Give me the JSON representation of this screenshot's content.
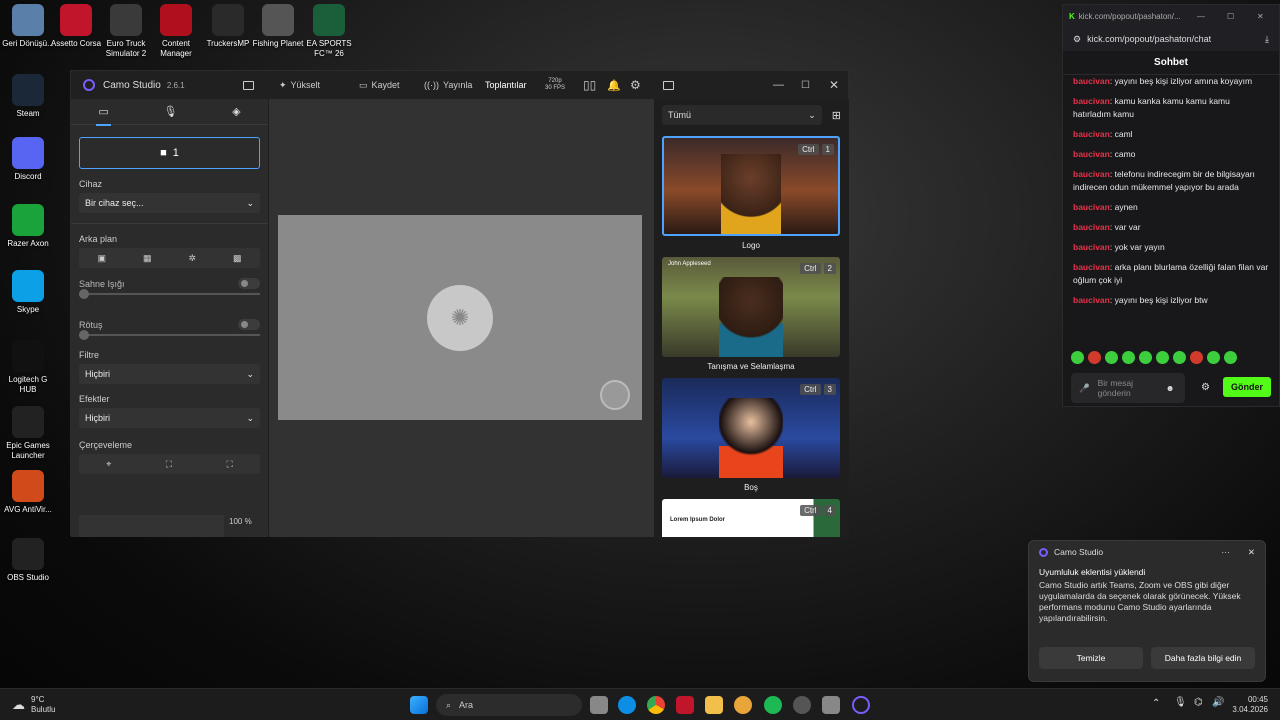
{
  "desktop": [
    {
      "label": "Geri Dönüşü...",
      "icon": "recycle-bin-icon",
      "color": "#5a7fa8"
    },
    {
      "label": "Assetto Corsa",
      "icon": "assetto-corsa-icon",
      "color": "#c0152a"
    },
    {
      "label": "Euro Truck Simulator 2",
      "icon": "ets2-icon",
      "color": "#3a3a3a"
    },
    {
      "label": "Content Manager",
      "icon": "content-manager-icon",
      "color": "#b0101e"
    },
    {
      "label": "TruckersMP",
      "icon": "truckersmp-icon",
      "color": "#2a2a2a"
    },
    {
      "label": "Fishing Planet",
      "icon": "fishing-planet-icon",
      "color": "#555"
    },
    {
      "label": "EA SPORTS FC™ 26",
      "icon": "ea-fc-icon",
      "color": "#1a5e3a"
    },
    {
      "label": "Steam",
      "icon": "steam-icon",
      "color": "#1b2838"
    },
    {
      "label": "Discord",
      "icon": "discord-icon",
      "color": "#5865f2"
    },
    {
      "label": "Razer Axon",
      "icon": "razer-icon",
      "color": "#1aa33a"
    },
    {
      "label": "Skype",
      "icon": "skype-icon",
      "color": "#0ca0e6"
    },
    {
      "label": "Logitech G HUB",
      "icon": "logitech-icon",
      "color": "#111"
    },
    {
      "label": "Epic Games Launcher",
      "icon": "epic-icon",
      "color": "#222"
    },
    {
      "label": "AVG AntiVir...",
      "icon": "avg-icon",
      "color": "#d04a1a"
    },
    {
      "label": "OBS Studio",
      "icon": "obs-icon",
      "color": "#222"
    }
  ],
  "camo": {
    "name": "Camo Studio",
    "version": "2.6.1",
    "toolbar": {
      "upgrade": "Yükselt",
      "record": "Kaydet",
      "broadcast": "Yayınla",
      "meetings": "Toplantılar",
      "resolution": "720p",
      "fps": "30 FPS"
    },
    "camera_label": "1",
    "device_label": "Cihaz",
    "device_value": "Bir cihaz seç...",
    "background_label": "Arka plan",
    "stage_light": "Sahne Işığı",
    "retouch": "Rötuş",
    "filter_label": "Filtre",
    "filter_value": "Hiçbiri",
    "effects_label": "Efektler",
    "effects_value": "Hiçbiri",
    "framing_label": "Çerçeveleme",
    "zoom_value": "100 %",
    "scene_filter": "Tümü",
    "ctrl_key": "Ctrl",
    "scenes": [
      {
        "num": "1",
        "caption": "Logo"
      },
      {
        "num": "2",
        "caption": "Tanışma ve Selamlaşma",
        "overlay": "John Appleseed"
      },
      {
        "num": "3",
        "caption": "Boş"
      },
      {
        "num": "4",
        "caption": "",
        "overlay": "Lorem Ipsum Dolor"
      }
    ]
  },
  "chat": {
    "tab_url": "kick.com/popout/pashaton/...",
    "url": "kick.com/popout/pashaton/chat",
    "header": "Sohbet",
    "messages": [
      {
        "user": "baucivan",
        "text": "yayını beş kişi izliyor amına koyayım"
      },
      {
        "user": "baucivan",
        "text": "kamu kanka kamu kamu kamu hatırladım kamu"
      },
      {
        "user": "baucivan",
        "text": "caml"
      },
      {
        "user": "baucivan",
        "text": "camo"
      },
      {
        "user": "baucivan",
        "text": "telefonu indirecegim bir de bilgisayarı indirecen odun mükemmel yapıyor bu arada"
      },
      {
        "user": "baucivan",
        "text": "aynen"
      },
      {
        "user": "baucivan",
        "text": "var var"
      },
      {
        "user": "baucivan",
        "text": "yok var yayın"
      },
      {
        "user": "baucivan",
        "text": "arka planı blurlama özelliği falan filan var oğlum çok iyi"
      },
      {
        "user": "baucivan",
        "text": "yayını beş kişi izliyor btw"
      }
    ],
    "input_placeholder": "Bir mesaj gönderin",
    "send_label": "Gönder"
  },
  "toast": {
    "app": "Camo Studio",
    "title": "Uyumluluk eklentisi yüklendi",
    "body": "Camo Studio artık Teams, Zoom ve OBS gibi diğer uygulamalarda da seçenek olarak görünecek. Yüksek performans modunu Camo Studio ayarlarında yapılandırabilirsin.",
    "btn_clear": "Temizle",
    "btn_more": "Daha fazla bilgi edin"
  },
  "taskbar": {
    "temp": "9°C",
    "weather": "Bulutlu",
    "search_placeholder": "Ara",
    "time": "00:45",
    "date": "3.04.2026"
  }
}
